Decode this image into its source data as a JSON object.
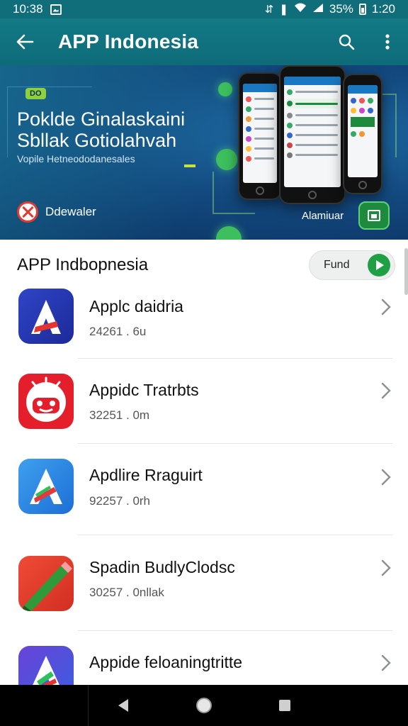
{
  "status_bar": {
    "time": "10:38",
    "battery": "35%",
    "clock_right": "1:20"
  },
  "app_bar": {
    "title": "APP Indonesia",
    "icons": [
      "back-arrow-icon",
      "search-icon",
      "more-vert-icon"
    ]
  },
  "banner": {
    "tag": "DO",
    "headline_1": "Poklde Ginalaskaini",
    "headline_2": "Sbllak Gotiolahvah",
    "subtitle": "Vopile Hetneododanesales",
    "brand_name": "Ddewaler",
    "cta_label": "Alamiuar",
    "accent": "#1e8a3e"
  },
  "section": {
    "title": "APP Indbopnesia",
    "button_label": "Fund",
    "button_color": "#1fa044"
  },
  "apps": [
    {
      "name": "Applc daidria",
      "meta": "24261 . 6u",
      "icon": "app-a-icon-blue"
    },
    {
      "name": "Appidc Tratrbts",
      "meta": "32251 . 0m",
      "icon": "app-face-icon-red"
    },
    {
      "name": "Apdlire Rraguirt",
      "meta": "92257 . 0rh",
      "icon": "app-a-icon-lightblue"
    },
    {
      "name": "Spadin BudlyClodsc",
      "meta": "30257 . 0nllak",
      "icon": "app-pen-icon-red"
    },
    {
      "name": "Appide feloaningtritte",
      "meta": "",
      "icon": "app-a-icon-purple"
    }
  ],
  "nav": {
    "icons": [
      "back-triangle-icon",
      "home-circle-icon",
      "recents-square-icon"
    ]
  }
}
